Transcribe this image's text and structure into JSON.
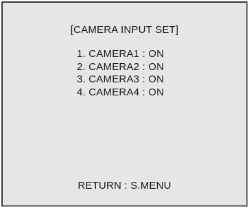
{
  "menu": {
    "title": "[CAMERA INPUT SET]",
    "items": [
      {
        "label": "1. CAMERA1 : ON"
      },
      {
        "label": "2. CAMERA2 : ON"
      },
      {
        "label": "3. CAMERA3 : ON"
      },
      {
        "label": "4. CAMERA4 : ON"
      }
    ],
    "footer": "RETURN : S.MENU"
  }
}
